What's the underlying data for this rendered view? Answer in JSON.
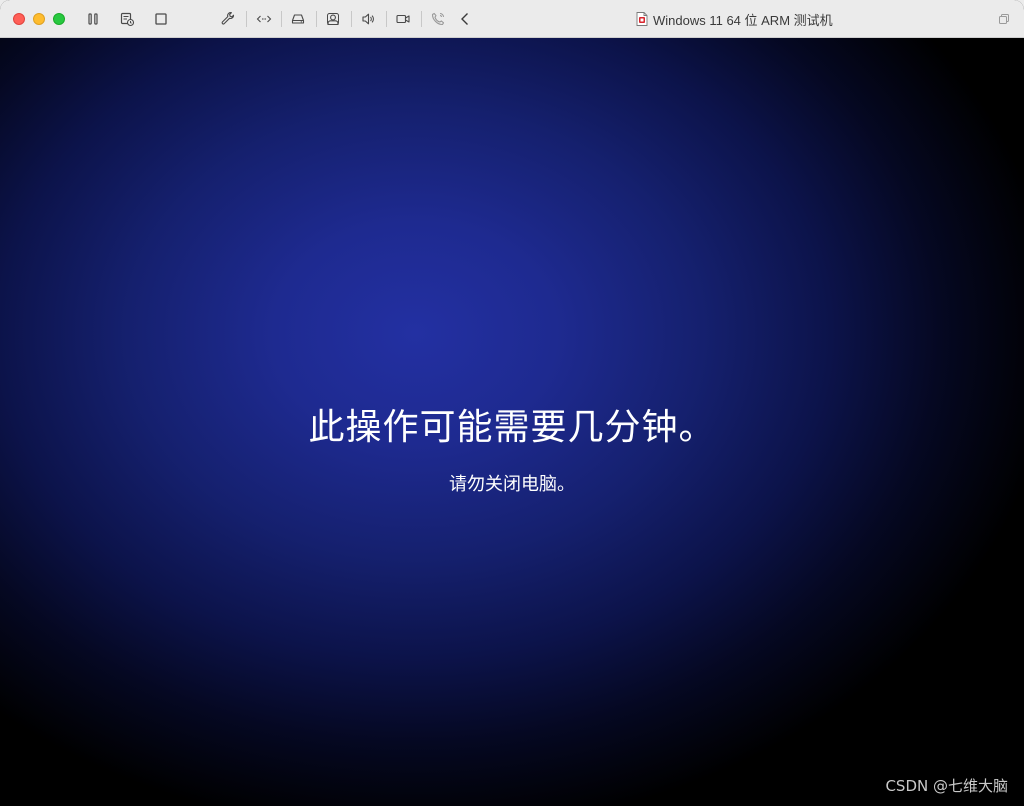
{
  "window": {
    "title": "Windows 11 64 位 ARM 测试机"
  },
  "toolbar": {
    "icons": [
      "pause-icon",
      "snapshot-icon",
      "stop-icon",
      "settings-wrench-icon",
      "code-arrows-icon",
      "disk-drive-icon",
      "user-account-icon",
      "speaker-icon",
      "camera-icon",
      "phone-call-icon",
      "back-chevron-icon",
      "window-restore-icon"
    ]
  },
  "screen": {
    "message": "此操作可能需要几分钟。",
    "submessage": "请勿关闭电脑。",
    "watermark": "CSDN @七维大脑"
  },
  "colors": {
    "close": "#ff5f57",
    "minimize": "#febc2e",
    "maximize": "#28c840",
    "screen_center": "#2330a2",
    "screen_edge": "#000000"
  }
}
